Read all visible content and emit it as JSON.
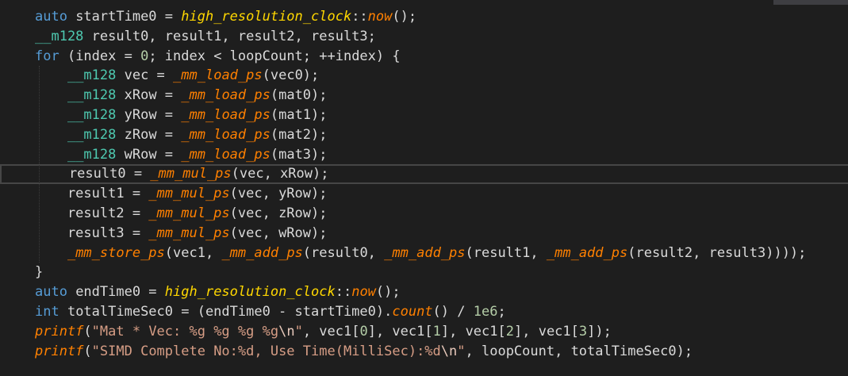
{
  "editor": {
    "colors": {
      "background": "#1e1e1e",
      "plain": "#dadada",
      "keyword": "#569cd6",
      "type": "#4ec9b0",
      "function": "#ff8000",
      "clock": "#ffd700",
      "string": "#d69d85",
      "number": "#b5cea8",
      "current_line_border": "#464646"
    },
    "current_line": 8,
    "lines": [
      [
        [
          "kw",
          "auto"
        ],
        [
          "p",
          " startTime0 = "
        ],
        [
          "ns",
          "high_resolution_clock"
        ],
        [
          "p",
          "::"
        ],
        [
          "fn",
          "now"
        ],
        [
          "p",
          "();"
        ]
      ],
      [
        [
          "type",
          "__m128"
        ],
        [
          "p",
          " result0, result1, result2, result3;"
        ]
      ],
      [
        [
          "kw",
          "for"
        ],
        [
          "p",
          " (index = "
        ],
        [
          "num",
          "0"
        ],
        [
          "p",
          "; index < loopCount; ++index) {"
        ]
      ],
      [
        [
          "p",
          "    "
        ],
        [
          "type",
          "__m128"
        ],
        [
          "p",
          " vec = "
        ],
        [
          "fn",
          "_mm_load_ps"
        ],
        [
          "p",
          "(vec0);"
        ]
      ],
      [
        [
          "p",
          "    "
        ],
        [
          "type",
          "__m128"
        ],
        [
          "p",
          " xRow = "
        ],
        [
          "fn",
          "_mm_load_ps"
        ],
        [
          "p",
          "(mat0);"
        ]
      ],
      [
        [
          "p",
          "    "
        ],
        [
          "type",
          "__m128"
        ],
        [
          "p",
          " yRow = "
        ],
        [
          "fn",
          "_mm_load_ps"
        ],
        [
          "p",
          "(mat1);"
        ]
      ],
      [
        [
          "p",
          "    "
        ],
        [
          "type",
          "__m128"
        ],
        [
          "p",
          " zRow = "
        ],
        [
          "fn",
          "_mm_load_ps"
        ],
        [
          "p",
          "(mat2);"
        ]
      ],
      [
        [
          "p",
          "    "
        ],
        [
          "type",
          "__m128"
        ],
        [
          "p",
          " wRow = "
        ],
        [
          "fn",
          "_mm_load_ps"
        ],
        [
          "p",
          "(mat3);"
        ]
      ],
      [
        [
          "p",
          "    result0 = "
        ],
        [
          "fn",
          "_mm_mul_ps"
        ],
        [
          "p",
          "(vec, xRow);"
        ]
      ],
      [
        [
          "p",
          "    result1 = "
        ],
        [
          "fn",
          "_mm_mul_ps"
        ],
        [
          "p",
          "(vec, yRow);"
        ]
      ],
      [
        [
          "p",
          "    result2 = "
        ],
        [
          "fn",
          "_mm_mul_ps"
        ],
        [
          "p",
          "(vec, zRow);"
        ]
      ],
      [
        [
          "p",
          "    result3 = "
        ],
        [
          "fn",
          "_mm_mul_ps"
        ],
        [
          "p",
          "(vec, wRow);"
        ]
      ],
      [
        [
          "p",
          "    "
        ],
        [
          "fn",
          "_mm_store_ps"
        ],
        [
          "p",
          "(vec1, "
        ],
        [
          "fn",
          "_mm_add_ps"
        ],
        [
          "p",
          "(result0, "
        ],
        [
          "fn",
          "_mm_add_ps"
        ],
        [
          "p",
          "(result1, "
        ],
        [
          "fn",
          "_mm_add_ps"
        ],
        [
          "p",
          "(result2, result3))));"
        ]
      ],
      [
        [
          "p",
          "}"
        ]
      ],
      [
        [
          "kw",
          "auto"
        ],
        [
          "p",
          " endTime0 = "
        ],
        [
          "ns",
          "high_resolution_clock"
        ],
        [
          "p",
          "::"
        ],
        [
          "fn",
          "now"
        ],
        [
          "p",
          "();"
        ]
      ],
      [
        [
          "kw",
          "int"
        ],
        [
          "p",
          " totalTimeSec0 = (endTime0 - startTime0)."
        ],
        [
          "fn",
          "count"
        ],
        [
          "p",
          "() / "
        ],
        [
          "num",
          "1e6"
        ],
        [
          "p",
          ";"
        ]
      ],
      [
        [
          "fn",
          "printf"
        ],
        [
          "p",
          "("
        ],
        [
          "str",
          "\"Mat * Vec: %g %g %g %g"
        ],
        [
          "esc",
          "\\n"
        ],
        [
          "str",
          "\""
        ],
        [
          "p",
          ", vec1["
        ],
        [
          "num",
          "0"
        ],
        [
          "p",
          "], vec1["
        ],
        [
          "num",
          "1"
        ],
        [
          "p",
          "], vec1["
        ],
        [
          "num",
          "2"
        ],
        [
          "p",
          "], vec1["
        ],
        [
          "num",
          "3"
        ],
        [
          "p",
          "]);"
        ]
      ],
      [
        [
          "fn",
          "printf"
        ],
        [
          "p",
          "("
        ],
        [
          "str",
          "\"SIMD Complete No:%d, Use Time(MilliSec):%d"
        ],
        [
          "esc",
          "\\n"
        ],
        [
          "str",
          "\""
        ],
        [
          "p",
          ", loopCount, totalTimeSec0);"
        ]
      ]
    ]
  }
}
